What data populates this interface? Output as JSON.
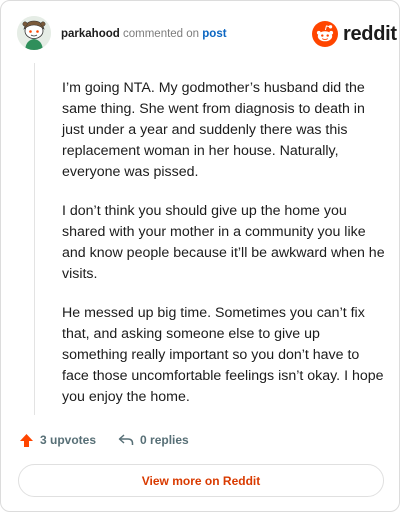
{
  "header": {
    "username": "parkahood",
    "commented_text": "commented on",
    "post_link": "post"
  },
  "brand": {
    "wordmark": "reddit",
    "color": "#ff4500"
  },
  "comment": {
    "paragraphs": [
      "I’m going NTA. My godmother’s husband did the same thing. She went from diagnosis to death in just under a year and suddenly there was this replacement woman in her house. Naturally, everyone was pissed.",
      "I don’t think you should give up the home you shared with your mother in a community you like and know people because it’ll be awkward when he visits.",
      "He messed up big time. Sometimes you can’t fix that, and asking someone else to give up something really important so you don’t have to face those uncomfortable feelings isn’t okay. I hope you enjoy the home."
    ]
  },
  "actions": {
    "upvotes": "3 upvotes",
    "replies": "0 replies"
  },
  "footer": {
    "view_more": "View more on Reddit",
    "accent": "#d93a00"
  }
}
